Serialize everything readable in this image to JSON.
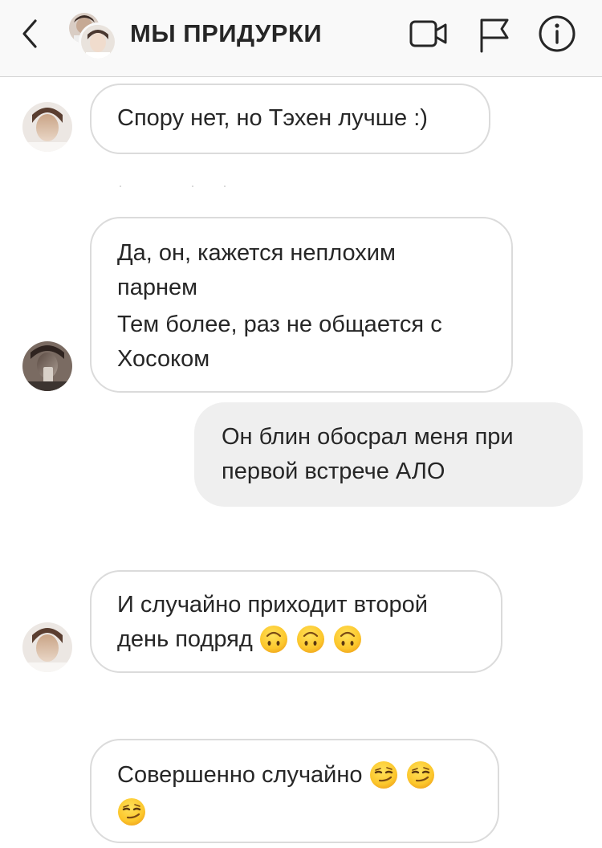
{
  "header": {
    "title": "МЫ ПРИДУРКИ"
  },
  "messages": [
    {
      "direction": "incoming",
      "lines": [
        "Спору нет, но Тэхен лучше :)"
      ]
    },
    {
      "direction": "incoming",
      "lines": [
        "Да, он, кажется неплохим",
        "парнем",
        "Тем более, раз не общается с",
        "Хосоком"
      ]
    },
    {
      "direction": "outgoing",
      "lines": [
        "Он блин обосрал меня при",
        "первой встрече АЛО"
      ]
    },
    {
      "direction": "incoming",
      "lines": [
        "И случайно приходит второй",
        "день подряд"
      ],
      "emoji": "upside-down-face-emoji",
      "emoji_count": 3
    },
    {
      "direction": "incoming",
      "lines": [
        "Совершенно случайно"
      ],
      "emoji": "smirking-face-emoji",
      "emoji_count": 3
    }
  ],
  "colors": {
    "header_bg": "#f9f9f9",
    "incoming_bubble_border": "#dbdbdb",
    "outgoing_bubble_bg": "#efefef",
    "text": "#262626",
    "emoji_yellow": "#ffcc33"
  },
  "icons": [
    "chevron-left-icon",
    "video-camera-icon",
    "flag-icon",
    "info-icon"
  ]
}
